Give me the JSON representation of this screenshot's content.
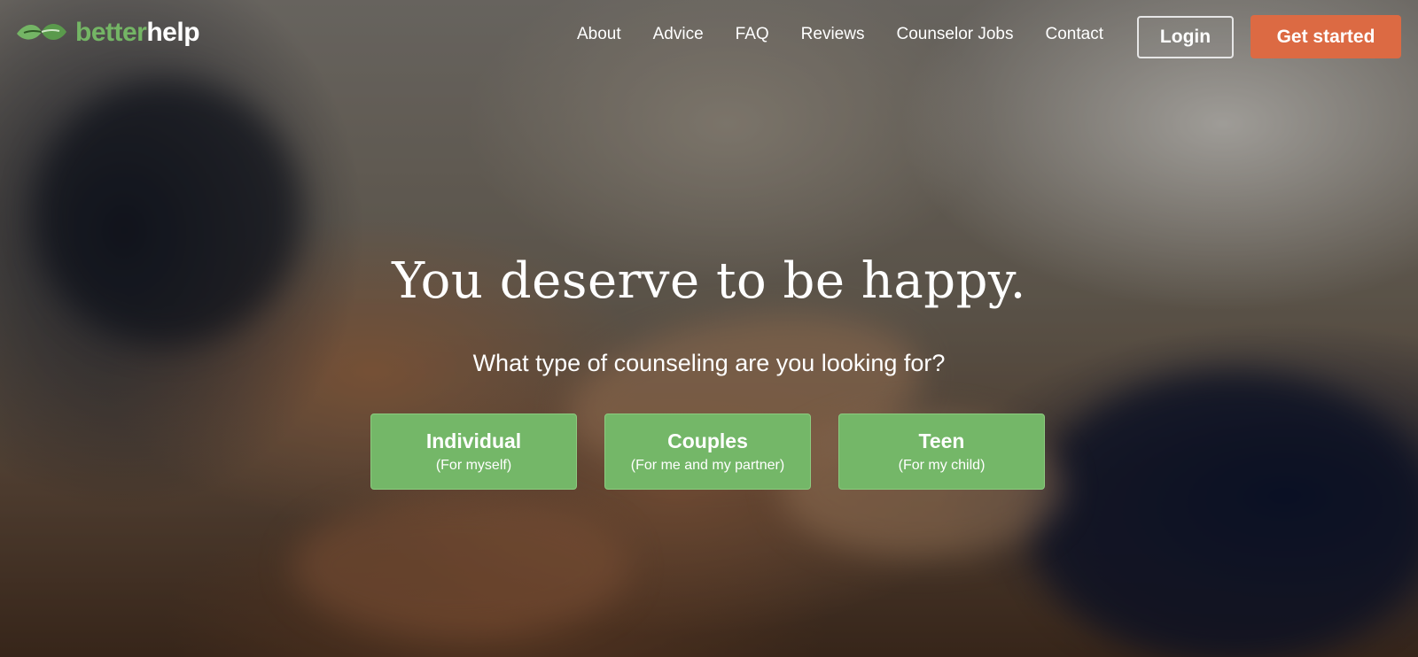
{
  "brand": {
    "logo_text_part1": "better",
    "logo_text_part2": "help",
    "accent_green": "#74b565",
    "accent_orange": "#dc6a43",
    "logo_icon": "leaf-hands-icon"
  },
  "nav": {
    "items": [
      {
        "label": "About"
      },
      {
        "label": "Advice"
      },
      {
        "label": "FAQ"
      },
      {
        "label": "Reviews"
      },
      {
        "label": "Counselor Jobs"
      },
      {
        "label": "Contact"
      }
    ],
    "login_label": "Login",
    "get_started_label": "Get started"
  },
  "hero": {
    "headline": "You deserve to be happy.",
    "subheadline": "What type of counseling are you looking for?",
    "choices": [
      {
        "title": "Individual",
        "subtitle": "(For myself)"
      },
      {
        "title": "Couples",
        "subtitle": "(For me and my partner)"
      },
      {
        "title": "Teen",
        "subtitle": "(For my child)"
      }
    ],
    "choice_color": "#74b768"
  }
}
